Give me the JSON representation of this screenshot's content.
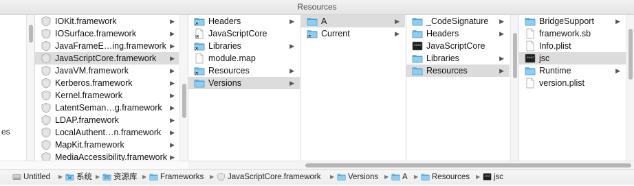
{
  "window": {
    "title": "Resources"
  },
  "left_stub": "es",
  "columns": [
    {
      "id": "c1",
      "items": [
        {
          "label": "IOKit.framework",
          "icon": "framework-icon",
          "folder": true
        },
        {
          "label": "IOSurface.framework",
          "icon": "framework-icon",
          "folder": true
        },
        {
          "label": "JavaFrameE…ing.framework",
          "icon": "framework-icon",
          "folder": true
        },
        {
          "label": "JavaScriptCore.framework",
          "icon": "framework-icon",
          "folder": true,
          "selected": true
        },
        {
          "label": "JavaVM.framework",
          "icon": "framework-icon",
          "folder": true
        },
        {
          "label": "Kerberos.framework",
          "icon": "framework-icon",
          "folder": true
        },
        {
          "label": "Kernel.framework",
          "icon": "framework-icon",
          "folder": true
        },
        {
          "label": "LatentSeman…g.framework",
          "icon": "framework-icon",
          "folder": true
        },
        {
          "label": "LDAP.framework",
          "icon": "framework-icon",
          "folder": true
        },
        {
          "label": "LocalAuthent…n.framework",
          "icon": "framework-icon",
          "folder": true
        },
        {
          "label": "MapKit.framework",
          "icon": "framework-icon",
          "folder": true
        },
        {
          "label": "MediaAccessibility.framework",
          "icon": "framework-icon",
          "folder": true
        }
      ]
    },
    {
      "id": "c2",
      "items": [
        {
          "label": "Headers",
          "icon": "alias-folder-icon",
          "folder": true
        },
        {
          "label": "JavaScriptCore",
          "icon": "alias-file-icon",
          "folder": false
        },
        {
          "label": "Libraries",
          "icon": "alias-folder-icon",
          "folder": true
        },
        {
          "label": "module.map",
          "icon": "document-icon",
          "folder": false
        },
        {
          "label": "Resources",
          "icon": "alias-folder-icon",
          "folder": true
        },
        {
          "label": "Versions",
          "icon": "folder-icon",
          "folder": true,
          "selected": true
        }
      ]
    },
    {
      "id": "c3",
      "items": [
        {
          "label": "A",
          "icon": "folder-icon",
          "folder": true,
          "selected": true
        },
        {
          "label": "Current",
          "icon": "alias-folder-icon",
          "folder": true
        }
      ]
    },
    {
      "id": "c4",
      "items": [
        {
          "label": "_CodeSignature",
          "icon": "folder-icon",
          "folder": true
        },
        {
          "label": "Headers",
          "icon": "folder-icon",
          "folder": true
        },
        {
          "label": "JavaScriptCore",
          "icon": "terminal-exec-icon",
          "folder": false
        },
        {
          "label": "Libraries",
          "icon": "folder-icon",
          "folder": true
        },
        {
          "label": "Resources",
          "icon": "folder-icon",
          "folder": true,
          "selected": true
        }
      ]
    },
    {
      "id": "c5",
      "items": [
        {
          "label": "BridgeSupport",
          "icon": "folder-icon",
          "folder": true
        },
        {
          "label": "framework.sb",
          "icon": "document-icon",
          "folder": false
        },
        {
          "label": "Info.plist",
          "icon": "document-icon",
          "folder": false
        },
        {
          "label": "jsc",
          "icon": "terminal-exec-icon",
          "folder": false,
          "selected": true
        },
        {
          "label": "Runtime",
          "icon": "folder-icon",
          "folder": true
        },
        {
          "label": "version.plist",
          "icon": "document-icon",
          "folder": false
        }
      ]
    }
  ],
  "path_bar": [
    {
      "label": "Untitled",
      "icon": "disk-icon"
    },
    {
      "label": "系统",
      "icon": "system-folder-icon"
    },
    {
      "label": "资源库",
      "icon": "library-folder-icon"
    },
    {
      "label": "Frameworks",
      "icon": "folder-icon"
    },
    {
      "label": "JavaScriptCore.framework",
      "icon": "framework-icon"
    },
    {
      "label": "Versions",
      "icon": "folder-icon"
    },
    {
      "label": "A",
      "icon": "folder-icon"
    },
    {
      "label": "Resources",
      "icon": "folder-icon"
    },
    {
      "label": "jsc",
      "icon": "terminal-exec-icon"
    }
  ],
  "colors": {
    "folder_blue": "#5db4ea",
    "selection_gray": "#dcdcdc",
    "terminal_black": "#1e1e1e"
  }
}
